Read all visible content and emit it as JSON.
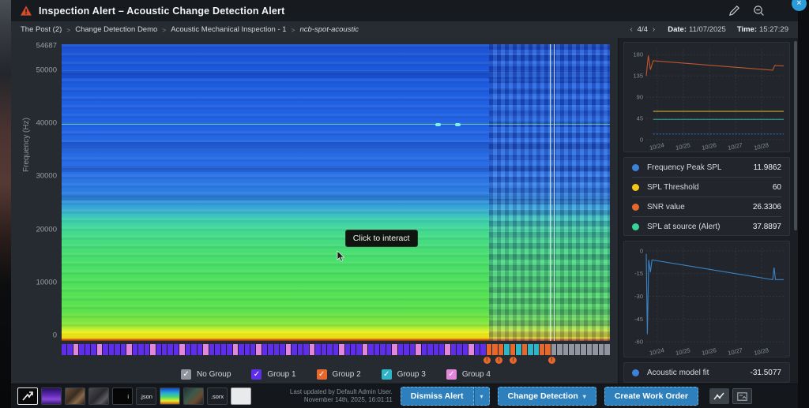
{
  "window": {
    "title": "Inspection Alert – Acoustic Change Detection Alert",
    "close_label": "×",
    "edit_icon": "pencil-icon",
    "zoom_icon": "zoom-out-icon"
  },
  "breadcrumb": {
    "items": [
      "The Post (2)",
      "Change Detection Demo",
      "Acoustic Mechanical Inspection - 1",
      "ncb-spot-acoustic"
    ],
    "separator": ">"
  },
  "header_meta": {
    "prev_arrow": "‹",
    "pagination": "4/4",
    "next_arrow": "›",
    "date_label": "Date:",
    "date_value": "11/07/2025",
    "time_label": "Time:",
    "time_value": "15:27:29"
  },
  "spectrogram": {
    "ylabel": "Frequency (Hz)",
    "y_max": 54687,
    "yticks": [
      54687,
      50000,
      40000,
      30000,
      20000,
      10000,
      0
    ],
    "tooltip": "Click to interact"
  },
  "groups_legend": {
    "check_glyph": "✓",
    "items": [
      {
        "label": "No Group",
        "color": "#9096a0"
      },
      {
        "label": "Group 1",
        "color": "#5f2eea"
      },
      {
        "label": "Group 2",
        "color": "#e8682c"
      },
      {
        "label": "Group 3",
        "color": "#2fb5c8"
      },
      {
        "label": "Group 4",
        "color": "#e387dd"
      }
    ]
  },
  "group_strip": {
    "repeat": "114111411",
    "repeat_count": 8,
    "tail": "22232323322NNNNNNNNNN",
    "colors": {
      "1": "#5f2eea",
      "2": "#e8682c",
      "3": "#2fb5c8",
      "4": "#e387dd",
      "N": "#9096a0"
    }
  },
  "alert_markers": {
    "glyph": "!",
    "positions_pct": [
      77.5,
      79.7,
      82.3,
      89.3
    ]
  },
  "side_panel": {
    "legend": [
      {
        "label": "Frequency Peak SPL",
        "value": "11.9862",
        "color": "#3b82d8"
      },
      {
        "label": "SPL Threshold",
        "value": "60",
        "color": "#f5c518"
      },
      {
        "label": "SNR value",
        "value": "26.3306",
        "color": "#e8682c"
      },
      {
        "label": "SPL at source (Alert)",
        "value": "37.8897",
        "color": "#35d49a"
      }
    ],
    "model_fit": {
      "label": "Acoustic model fit",
      "value": "-31.5077",
      "color": "#3b82d8"
    }
  },
  "chart_data": [
    {
      "type": "line",
      "x_ticks": [
        "10/24",
        "10/25",
        "10/26",
        "10/27",
        "10/28"
      ],
      "x_tick_fracs": [
        0.08,
        0.27,
        0.46,
        0.65,
        0.84
      ],
      "y_ticks": [
        180,
        135,
        90,
        45,
        0
      ],
      "ylim": [
        0,
        192
      ],
      "grid": true,
      "series": [
        {
          "name": "SNR value",
          "color": "#c0562e",
          "points": [
            [
              0,
              135
            ],
            [
              0.015,
              178
            ],
            [
              0.03,
              148
            ],
            [
              0.05,
              167
            ],
            [
              0.92,
              147
            ],
            [
              0.935,
              157
            ],
            [
              1,
              156
            ]
          ]
        },
        {
          "name": "SPL Threshold",
          "color": "#c8a82e",
          "points": [
            [
              0.05,
              60
            ],
            [
              1,
              60
            ]
          ]
        },
        {
          "name": "SPL at source (Alert)",
          "color": "#2ea89a",
          "points": [
            [
              0.05,
              43
            ],
            [
              1,
              43
            ]
          ]
        },
        {
          "name": "Frequency Peak SPL",
          "color": "#2e6ac0",
          "dashed": true,
          "points": [
            [
              0.05,
              12
            ],
            [
              1,
              12
            ]
          ]
        }
      ]
    },
    {
      "type": "line",
      "x_ticks": [
        "10/24",
        "10/25",
        "10/26",
        "10/27",
        "10/28"
      ],
      "x_tick_fracs": [
        0.08,
        0.27,
        0.46,
        0.65,
        0.84
      ],
      "y_ticks": [
        0,
        -15,
        -30,
        -45,
        -60
      ],
      "ylim": [
        -62,
        2
      ],
      "grid": true,
      "series": [
        {
          "name": "Acoustic model fit",
          "color": "#3a85c8",
          "points": [
            [
              0,
              -2
            ],
            [
              0.008,
              -55
            ],
            [
              0.018,
              -6
            ],
            [
              0.03,
              -14
            ],
            [
              0.042,
              -6
            ],
            [
              0.92,
              -19
            ],
            [
              0.93,
              -11
            ],
            [
              0.94,
              -19
            ],
            [
              1,
              -19
            ]
          ]
        }
      ]
    }
  ],
  "footer": {
    "last_updated_line1": "Last updated by Default Admin User.",
    "last_updated_line2": "November 14th, 2025, 16:01:11",
    "buttons": {
      "dismiss": "Dismiss Alert",
      "change_detection": "Change Detection",
      "create_work_order": "Create Work Order",
      "caret": "▾"
    },
    "thumbnails": [
      {
        "kind": "arrow",
        "name": "waveform-arrow-thumbnail",
        "label": ""
      },
      {
        "kind": "spectro-purple",
        "name": "purple-spectrogram-thumbnail",
        "label": ""
      },
      {
        "kind": "photo-brown",
        "name": "photo-thumbnail-1",
        "label": ""
      },
      {
        "kind": "photo-gray",
        "name": "photo-thumbnail-2",
        "label": ""
      },
      {
        "kind": "black-i",
        "name": "black-info-thumbnail",
        "label": "i"
      },
      {
        "kind": "label",
        "name": "json-file-thumbnail",
        "label": ".json"
      },
      {
        "kind": "spectro-color",
        "name": "color-spectrogram-thumbnail",
        "label": ""
      },
      {
        "kind": "photo-dark",
        "name": "photo-thumbnail-3",
        "label": ""
      },
      {
        "kind": "label",
        "name": "sorx-file-thumbnail",
        "label": ".sorx"
      },
      {
        "kind": "white-doc",
        "name": "white-document-thumbnail",
        "label": ""
      }
    ]
  }
}
